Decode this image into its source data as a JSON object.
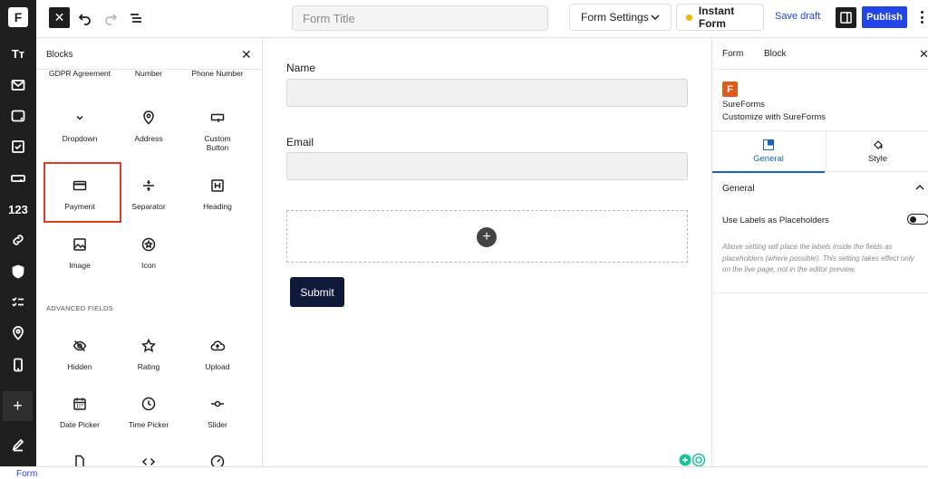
{
  "rail": {
    "logo_letter": "F",
    "items": [
      {
        "icon": "typography-icon",
        "label": "Tт"
      },
      {
        "icon": "envelope-icon"
      },
      {
        "icon": "textarea-icon"
      },
      {
        "icon": "checkbox-icon"
      },
      {
        "icon": "input-field-icon"
      },
      {
        "icon": "number-icon",
        "label": "123"
      },
      {
        "icon": "link-icon"
      },
      {
        "icon": "shield-icon"
      },
      {
        "icon": "checklist-icon"
      },
      {
        "icon": "location-icon"
      },
      {
        "icon": "mobile-icon"
      },
      {
        "icon": "plus-icon"
      },
      {
        "icon": "pen-icon"
      }
    ]
  },
  "toolbar": {
    "form_title_placeholder": "Form Title",
    "form_settings_label": "Form Settings",
    "instant_form_label": "Instant Form",
    "save_draft_label": "Save draft",
    "publish_label": "Publish"
  },
  "blocks_panel": {
    "title": "Blocks",
    "blocks": [
      {
        "label": "GDPR Agreement",
        "icon": "gdpr-icon"
      },
      {
        "label": "Number",
        "icon": "number-icon"
      },
      {
        "label": "Phone Number",
        "icon": "phone-icon"
      },
      {
        "label": "Dropdown",
        "icon": "chevron-down-icon"
      },
      {
        "label": "Address",
        "icon": "location-icon"
      },
      {
        "label": "Custom Button",
        "icon": "button-icon"
      },
      {
        "label": "Payment",
        "icon": "credit-card-icon"
      },
      {
        "label": "Separator",
        "icon": "separator-icon"
      },
      {
        "label": "Heading",
        "icon": "heading-icon"
      },
      {
        "label": "Image",
        "icon": "image-icon"
      },
      {
        "label": "Icon",
        "icon": "star-circle-icon"
      }
    ],
    "advanced_label": "ADVANCED FIELDS",
    "advanced": [
      {
        "label": "Hidden",
        "icon": "eye-off-icon"
      },
      {
        "label": "Rating",
        "icon": "star-icon"
      },
      {
        "label": "Upload",
        "icon": "cloud-upload-icon"
      },
      {
        "label": "Date Picker",
        "icon": "calendar-icon"
      },
      {
        "label": "Time Picker",
        "icon": "clock-icon"
      },
      {
        "label": "Slider",
        "icon": "slider-icon"
      }
    ]
  },
  "canvas": {
    "fields": [
      {
        "label": "Name",
        "value": ""
      },
      {
        "label": "Email",
        "value": ""
      }
    ],
    "submit_label": "Submit"
  },
  "settings": {
    "tabs": [
      "Form",
      "Block"
    ],
    "brand_name": "SureForms",
    "brand_desc": "Customize with SureForms",
    "subtabs": [
      "General",
      "Style"
    ],
    "section_title": "General",
    "option_label": "Use Labels as Placeholders",
    "option_on": false,
    "help_text": "Above setting will place the labels inside the fields as placeholders (where possible). This setting takes effect only on the live page, not in the editor preview."
  },
  "footer": {
    "breadcrumb": "Form"
  },
  "colors": {
    "accent": "#2145e6",
    "highlight": "#e03a20",
    "submit": "#0f1a3a",
    "brand": "#e05a1a"
  }
}
